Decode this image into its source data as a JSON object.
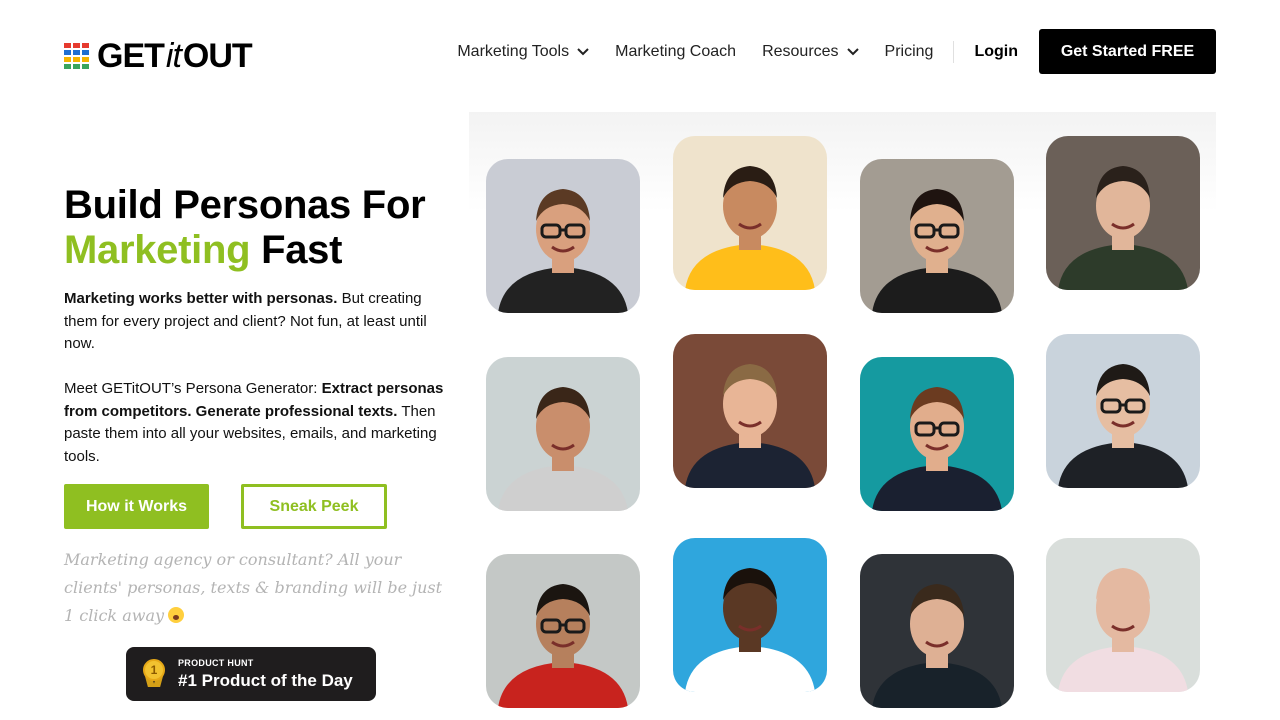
{
  "header": {
    "logo": {
      "text_before": "GET",
      "text_italic": "it",
      "text_after": "OUT",
      "mark_colors": [
        "#e63a2e",
        "#1f6fd1",
        "#f5b400",
        "#3ba55c"
      ]
    },
    "nav": [
      {
        "label": "Marketing Tools",
        "has_dropdown": true
      },
      {
        "label": "Marketing Coach",
        "has_dropdown": false
      },
      {
        "label": "Resources",
        "has_dropdown": true
      },
      {
        "label": "Pricing",
        "has_dropdown": false
      }
    ],
    "login_label": "Login",
    "cta_label": "Get Started FREE"
  },
  "hero": {
    "title_line1": "Build Personas For",
    "title_accent": "Marketing",
    "title_rest": "Fast",
    "p1_bold": "Marketing works better with personas.",
    "p1_rest": "But creating them for every project and client? Not fun, at least until now.",
    "p2_intro": "Meet GETitOUT’s Persona Generator:",
    "p2_bold": "Extract personas from competitors. Generate professional texts.",
    "p2_rest": "Then paste them into all your websites, emails, and marketing tools.",
    "btn_primary": "How it Works",
    "btn_secondary": "Sneak Peek",
    "handwritten": "Marketing agency or consultant? All your clients' personas, texts & branding will be just 1 click away",
    "accent_color": "#8fbf21"
  },
  "product_hunt": {
    "small": "PRODUCT HUNT",
    "big": "#1 Product of the Day",
    "medal_number": "1"
  },
  "personas": [
    {
      "name": "persona-1",
      "bg": "#c9ccd4",
      "skin": "#d9a07e",
      "hair": "#5b3a24",
      "shirt": "#222222",
      "glasses": true
    },
    {
      "name": "persona-2",
      "bg": "#efe3cc",
      "skin": "#c88a60",
      "hair": "#2a1d14",
      "shirt": "#ffbe1a",
      "glasses": false
    },
    {
      "name": "persona-3",
      "bg": "#a39c92",
      "skin": "#e0b08e",
      "hair": "#1f1410",
      "shirt": "#1c1c1c",
      "glasses": true
    },
    {
      "name": "persona-4",
      "bg": "#6b6058",
      "skin": "#e1b69a",
      "hair": "#2a211b",
      "shirt": "#2d3b2a",
      "glasses": false
    },
    {
      "name": "persona-5",
      "bg": "#cbd3d3",
      "skin": "#c98e6c",
      "hair": "#3a2618",
      "shirt": "#cfcfcf",
      "glasses": false
    },
    {
      "name": "persona-6",
      "bg": "#7a4a38",
      "skin": "#e8b596",
      "hair": "#8a6a44",
      "shirt": "#1c2333",
      "glasses": false
    },
    {
      "name": "persona-7",
      "bg": "#159aa0",
      "skin": "#e1ad8c",
      "hair": "#6b3b20",
      "shirt": "#1a2030",
      "glasses": true
    },
    {
      "name": "persona-8",
      "bg": "#c9d3dc",
      "skin": "#e6bea2",
      "hair": "#1f1a16",
      "shirt": "#1e2126",
      "glasses": true
    },
    {
      "name": "persona-9",
      "bg": "#c4c8c6",
      "skin": "#b6805d",
      "hair": "#1b1510",
      "shirt": "#c8231e",
      "glasses": true
    },
    {
      "name": "persona-10",
      "bg": "#2fa6dd",
      "skin": "#5a3824",
      "hair": "#1a110b",
      "shirt": "#ffffff",
      "glasses": false
    },
    {
      "name": "persona-11",
      "bg": "#2f3338",
      "skin": "#deb094",
      "hair": "#3a2a1c",
      "shirt": "#18222a",
      "glasses": false
    },
    {
      "name": "persona-12",
      "bg": "#d9dedb",
      "skin": "#e4b9a1",
      "hair": "#e4b9a1",
      "shirt": "#f1dde2",
      "glasses": false
    }
  ]
}
